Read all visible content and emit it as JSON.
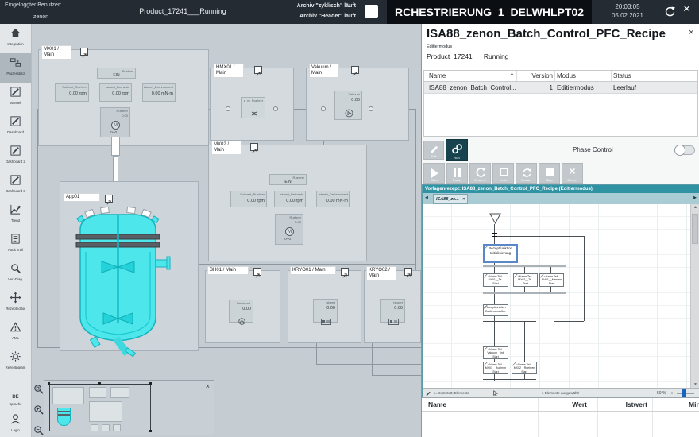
{
  "colors": {
    "topbar_dark": "#252b33",
    "station_box_black": "#0b0f14",
    "vessel_cyan": "#4de6ea",
    "vessel_cyan_stroke": "#14b4bf",
    "pfc_titlebar_teal": "#2f93a4",
    "run_button_dark": "#17434f",
    "selected_step_blue": "#5b87c8",
    "slider_blue": "#1565c0"
  },
  "topbar": {
    "user_label": "Eingeloggter Benutzer:",
    "user_name": "zenon",
    "product": "Product_17241___Running",
    "archive_line1": "Archiv \"zyklisch\" läuft",
    "archive_line2": "Archiv \"Header\" läuft",
    "station": "RCHESTRIERUNG_1_DELWHLPT02",
    "time": "20:03:05",
    "date": "05.02.2021"
  },
  "sidebar": {
    "items": [
      {
        "label": "Integration"
      },
      {
        "label": "Prozessbild"
      },
      {
        "label": "Manuell"
      },
      {
        "label": "Dashboard"
      },
      {
        "label": "Dashboard 2"
      },
      {
        "label": "Dashboard 3"
      },
      {
        "label": "Trend"
      },
      {
        "label": "Audit Trail"
      },
      {
        "label": "Ver.-Diag."
      },
      {
        "label": "Rezepteditor"
      },
      {
        "label": "AML"
      },
      {
        "label": "Rezeptparam"
      }
    ],
    "language_code": "DE",
    "language_label": "Sprache",
    "login_label": "Login"
  },
  "process": {
    "mx01": {
      "title1": "MX01 /",
      "title2": "Main",
      "status_label": "Ruehrer",
      "status_value": "EIN",
      "values": [
        {
          "label": "Sollwert_Ruehrer",
          "value": "0.00 rpm"
        },
        {
          "label": "Istwert_Drehzahl",
          "value": "0.00 rpm"
        },
        {
          "label": "Istwert_Drehmoment",
          "value": "0.00 mN·m"
        }
      ],
      "motor_label": "Ruehrer",
      "motor_value": "0.00",
      "motor_icon": "M"
    },
    "hmx01": {
      "title1": "HMX01 /",
      "title2": "Main",
      "box_label": "a_m_Ruehrer"
    },
    "vakuum": {
      "title1": "Vakuum /",
      "title2": "Main",
      "box_label": "Vakuum",
      "box_value": "0.00"
    },
    "mx02": {
      "title1": "MX02 /",
      "title2": "Main",
      "status_label": "Ruehrer",
      "status_value": "EIN",
      "values": [
        {
          "label": "Sollwert_Ruehrer",
          "value": "0.00 rpm"
        },
        {
          "label": "Istwert_Drehzahl",
          "value": "0.00 rpm"
        },
        {
          "label": "Istwert_Drehmoment",
          "value": "0.00 mN·m"
        }
      ],
      "motor_label": "Ruehrer",
      "motor_value": "0.00",
      "motor_icon": "M"
    },
    "app01": {
      "title": "App01"
    },
    "bh01": {
      "title": "BH01 / Main",
      "box_label": "Druckhalt.",
      "box_value": "0.00"
    },
    "kryo01": {
      "title": "KRYO01 / Main",
      "box_label": "Istwert",
      "box_value": "0.00"
    },
    "kryo02": {
      "title1": "KRYO02 /",
      "title2": "Main",
      "box_label": "Istwert",
      "box_value": "0.00"
    }
  },
  "recipe": {
    "title": "ISA88_zenon_Batch_Control_PFC_Recipe",
    "mode": "Editiermodus",
    "product": "Product_17241___Running",
    "table": {
      "col_name": "Name",
      "col_version": "Version",
      "col_modus": "Modus",
      "col_status": "Status",
      "row": {
        "name": "ISA88_zenon_Batch_Control...",
        "version": "1",
        "modus": "Editiermodus",
        "status": "Leerlauf"
      }
    },
    "edit_label": "Edit",
    "run_label": "Run",
    "phase_control_label": "Phase Control",
    "transport": [
      {
        "label": "Start"
      },
      {
        "label": "Pause"
      },
      {
        "label": "Resume"
      },
      {
        "label": "Hold"
      },
      {
        "label": "Restart"
      },
      {
        "label": "Stop"
      },
      {
        "label": "Cancel"
      }
    ]
  },
  "pfc": {
    "window_title": "Vorlagenrezept: ISA88_zenon_Batch_Control_PFC_Recipe (Editiermodus)",
    "tab_label": "ISA88_ze...",
    "step_init": {
      "l1": "Rezeptfunktion",
      "l2": "Initialisierung"
    },
    "par_steps": [
      {
        "l1": "<Name Teil..",
        "l2": "MX01__Te..",
        "l3": "Start"
      },
      {
        "l1": "<Name Teil..",
        "l2": "MX02__Te..",
        "l3": "Start"
      },
      {
        "l1": "<Name Teil..",
        "l2": "BH01__Messen",
        "l3": "Start"
      }
    ],
    "step_bedien": {
      "l1": "Rezeptfunktion",
      "l2": "Bedienerauffor."
    },
    "step_vakuum": {
      "l1": "<Name Teil..",
      "l2": "Vakuum__Init",
      "l3": "Start"
    },
    "seq_steps": [
      {
        "l1": "<Name Teil..",
        "l2": "MX01__Ruehren",
        "l3": "Start"
      },
      {
        "l1": "<Name Teil..",
        "l2": "MX02__Ruehren",
        "l3": "Start"
      }
    ],
    "status_left": "x= 0; 346x0; Elemente",
    "status_selection": "1 Elemente ausgewählt",
    "status_zoom": "50 %"
  },
  "param_table": {
    "col_name": "Name",
    "col_wert": "Wert",
    "col_istwert": "Istwert",
    "col_min": "Min"
  }
}
